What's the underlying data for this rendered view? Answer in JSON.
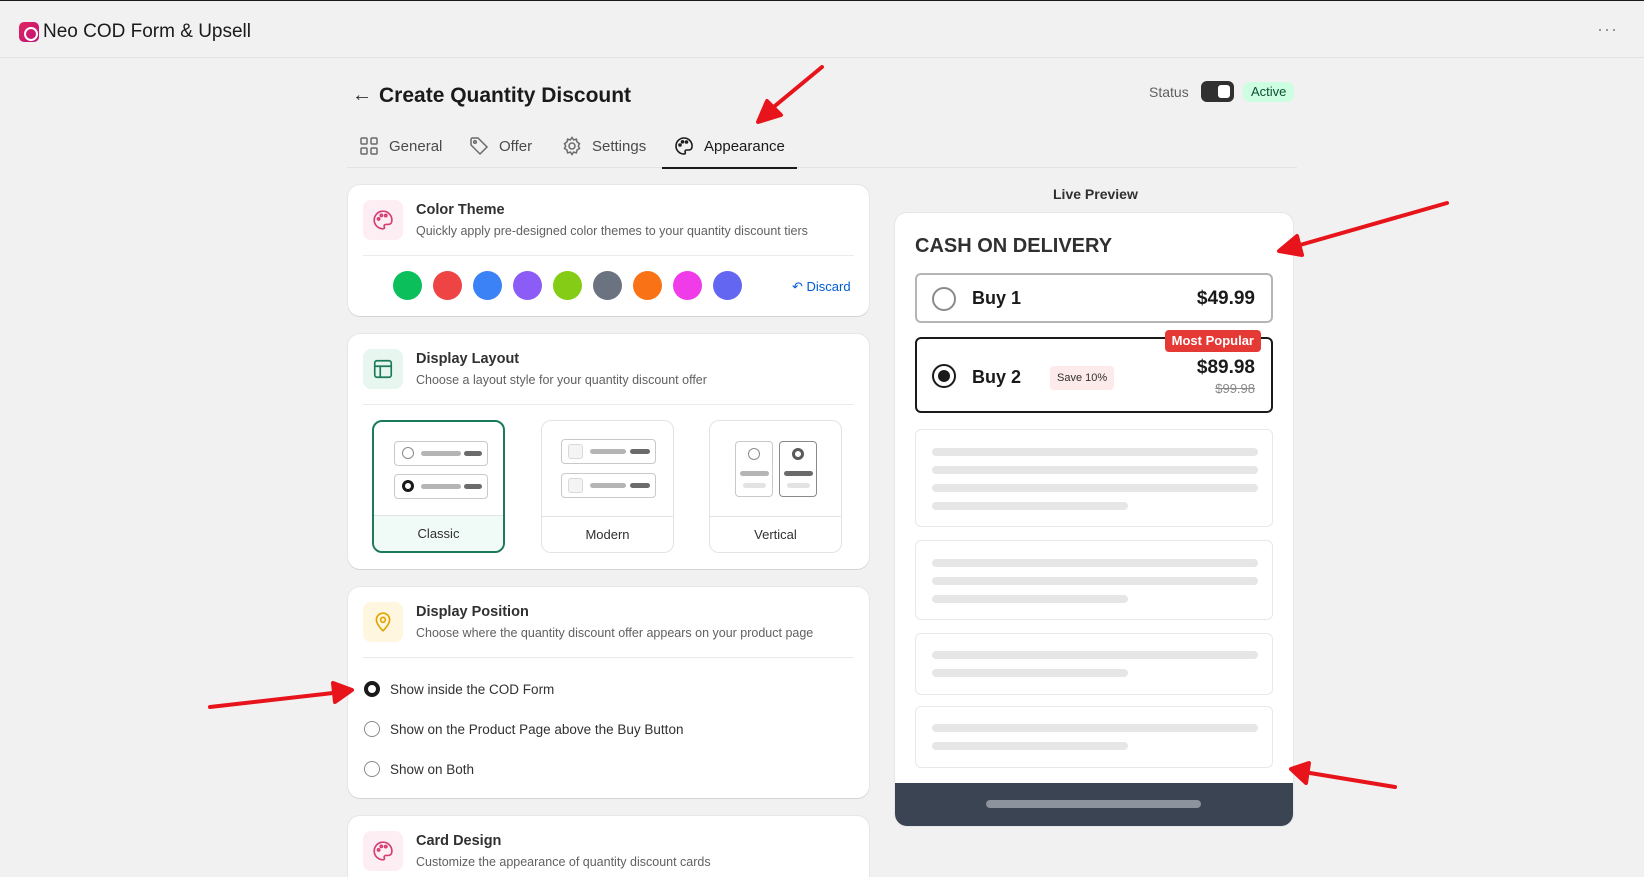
{
  "app": {
    "title": "Neo COD Form & Upsell",
    "more": "···"
  },
  "header": {
    "back": "←",
    "title": "Create Quantity Discount",
    "status_label": "Status",
    "status_value": "Active"
  },
  "tabs": [
    {
      "label": "General",
      "icon": "grid-icon"
    },
    {
      "label": "Offer",
      "icon": "tag-icon"
    },
    {
      "label": "Settings",
      "icon": "gear-icon"
    },
    {
      "label": "Appearance",
      "icon": "palette-icon",
      "active": true
    }
  ],
  "color_theme": {
    "title": "Color Theme",
    "subtitle": "Quickly apply pre-designed color themes to your quantity discount tiers",
    "swatches": [
      "#0bc05a",
      "#ef4444",
      "#3b82f6",
      "#8b5cf6",
      "#84cc16",
      "#6b7280",
      "#f97316",
      "#f03be8",
      "#6366f1"
    ],
    "discard_label": "Discard"
  },
  "display_layout": {
    "title": "Display Layout",
    "subtitle": "Choose a layout style for your quantity discount offer",
    "options": [
      {
        "label": "Classic",
        "selected": true
      },
      {
        "label": "Modern",
        "selected": false
      },
      {
        "label": "Vertical",
        "selected": false
      }
    ]
  },
  "display_position": {
    "title": "Display Position",
    "subtitle": "Choose where the quantity discount offer appears on your product page",
    "options": [
      {
        "label": "Show inside the COD Form",
        "selected": true
      },
      {
        "label": "Show on the Product Page above the Buy Button",
        "selected": false
      },
      {
        "label": "Show on Both",
        "selected": false
      }
    ]
  },
  "card_design": {
    "title": "Card Design",
    "subtitle": "Customize the appearance of quantity discount cards"
  },
  "preview": {
    "title": "Live Preview",
    "heading": "CASH ON DELIVERY",
    "offers": [
      {
        "name": "Buy 1",
        "price": "$49.99",
        "selected": false
      },
      {
        "name": "Buy 2",
        "price": "$89.98",
        "compare_price": "$99.98",
        "save": "Save 10%",
        "badge": "Most Popular",
        "selected": true
      }
    ]
  },
  "colors": {
    "accent": "#1b7a5a",
    "active_badge": "#cdfee1",
    "popular": "#e53935",
    "footer": "#3b4452",
    "arrow": "#e8141b"
  }
}
